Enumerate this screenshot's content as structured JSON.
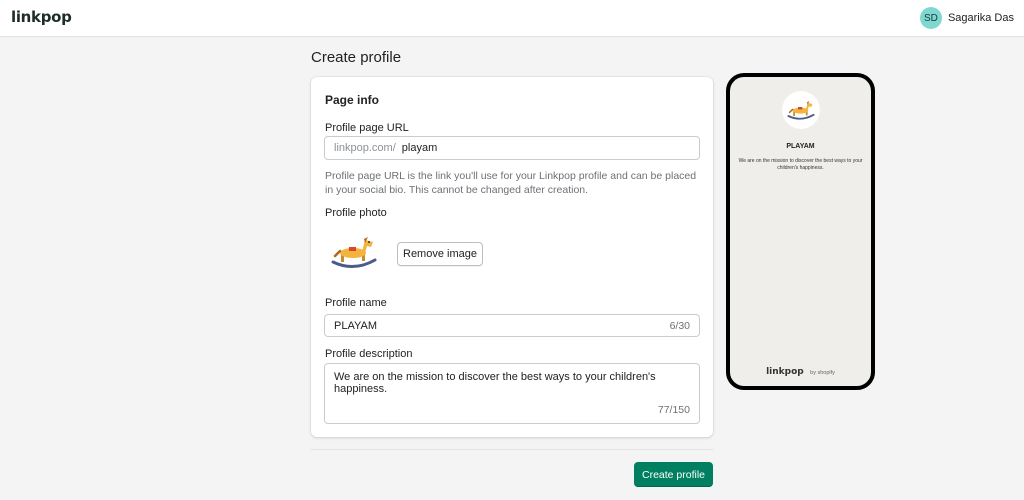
{
  "header": {
    "logo": "linkpop",
    "user": {
      "initials": "SD",
      "name": "Sagarika Das"
    }
  },
  "page": {
    "title": "Create profile"
  },
  "form": {
    "section_title": "Page info",
    "url": {
      "label": "Profile page URL",
      "prefix": "linkpop.com/",
      "value": "playam",
      "help": "Profile page URL is the link you'll use for your Linkpop profile and can be placed in your social bio. This cannot be changed after creation."
    },
    "photo": {
      "label": "Profile photo",
      "remove_label": "Remove image",
      "icon": "rocking-horse-icon"
    },
    "name": {
      "label": "Profile name",
      "value": "PLAYAM",
      "counter": "6/30"
    },
    "description": {
      "label": "Profile description",
      "value": "We are on the mission to discover the best ways to your children's happiness.",
      "counter": "77/150"
    }
  },
  "actions": {
    "create_label": "Create profile"
  },
  "preview": {
    "name": "PLAYAM",
    "description": "We are on the mission to discover the best ways to your children's happiness.",
    "footer_logo": "linkpop",
    "footer_by": "by shopify"
  },
  "colors": {
    "primary_button": "#008060",
    "avatar": "#7fd8d0",
    "page_background": "#f4f4f4",
    "preview_background": "#efeeeb"
  }
}
